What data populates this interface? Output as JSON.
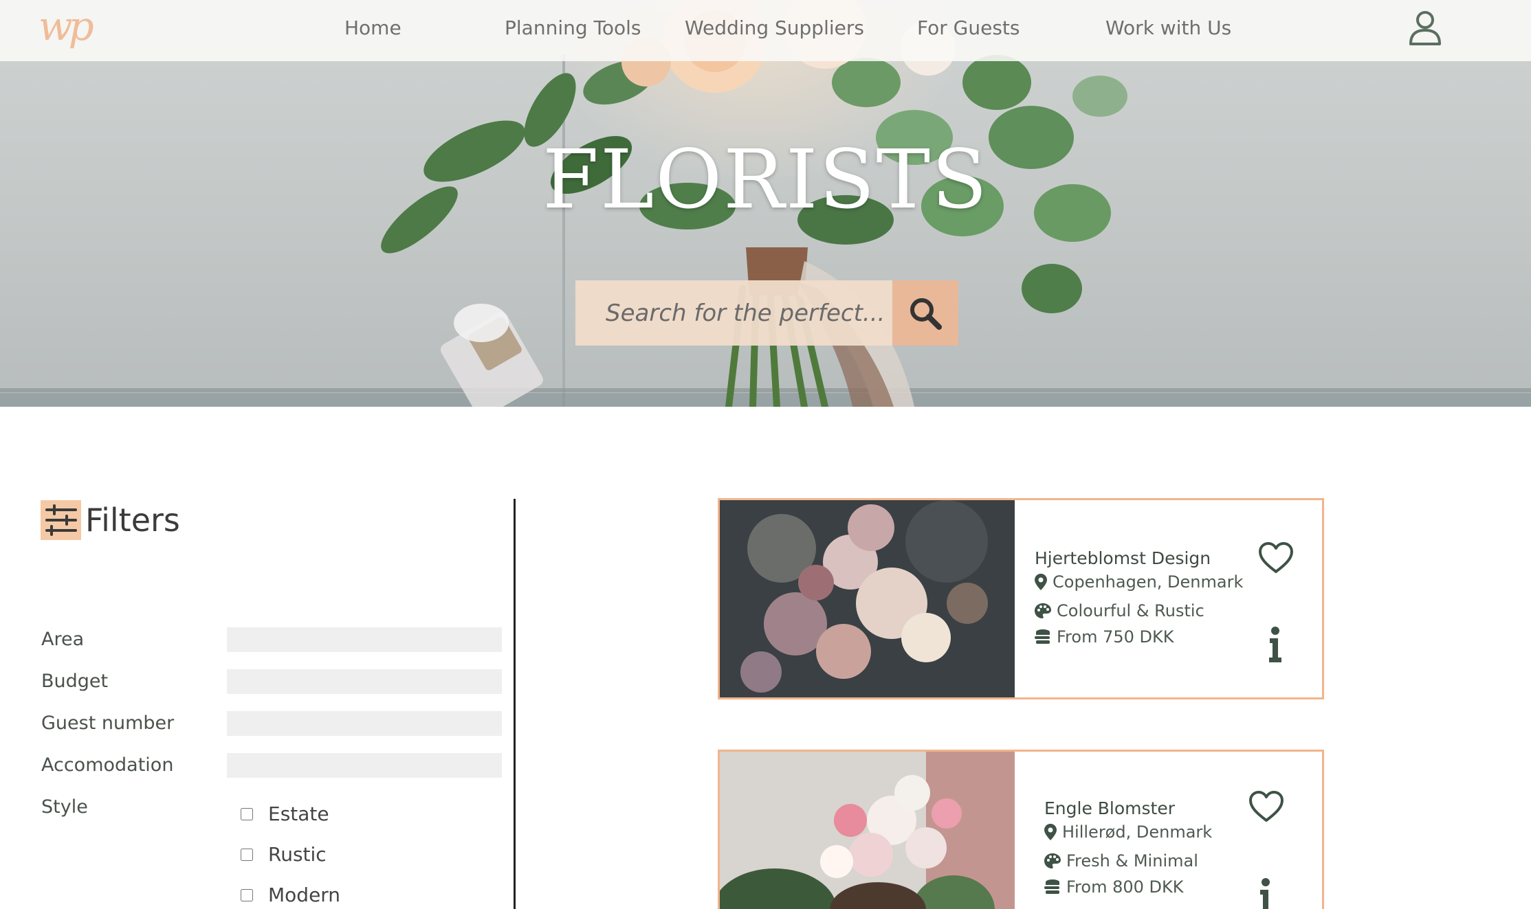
{
  "nav": {
    "logo": "wp",
    "links": [
      "Home",
      "Planning Tools",
      "Wedding Suppliers",
      "For Guests",
      "Work with Us"
    ]
  },
  "hero": {
    "title": "FLORISTS",
    "search_placeholder": "Search for the perfect..."
  },
  "filters": {
    "title": "Filters",
    "fields": [
      "Area",
      "Budget",
      "Guest number",
      "Accomodation",
      "Style"
    ],
    "style_options": [
      "Estate",
      "Rustic",
      "Modern"
    ]
  },
  "suppliers": [
    {
      "name": "Hjerteblomst Design",
      "location": "Copenhagen, Denmark",
      "style": "Colourful & Rustic",
      "price": "From 750 DKK"
    },
    {
      "name": "Engle Blomster",
      "location": "Hillerød, Denmark",
      "style": "Fresh & Minimal",
      "price": "From 800 DKK"
    }
  ],
  "colors": {
    "accent": "#f2b48c",
    "icon_green": "#3e5245",
    "search_button": "#e8b899"
  },
  "icons": [
    "user-icon",
    "search-icon",
    "filter-sliders-icon",
    "map-pin-icon",
    "palette-icon",
    "coins-icon",
    "heart-icon",
    "info-icon"
  ]
}
